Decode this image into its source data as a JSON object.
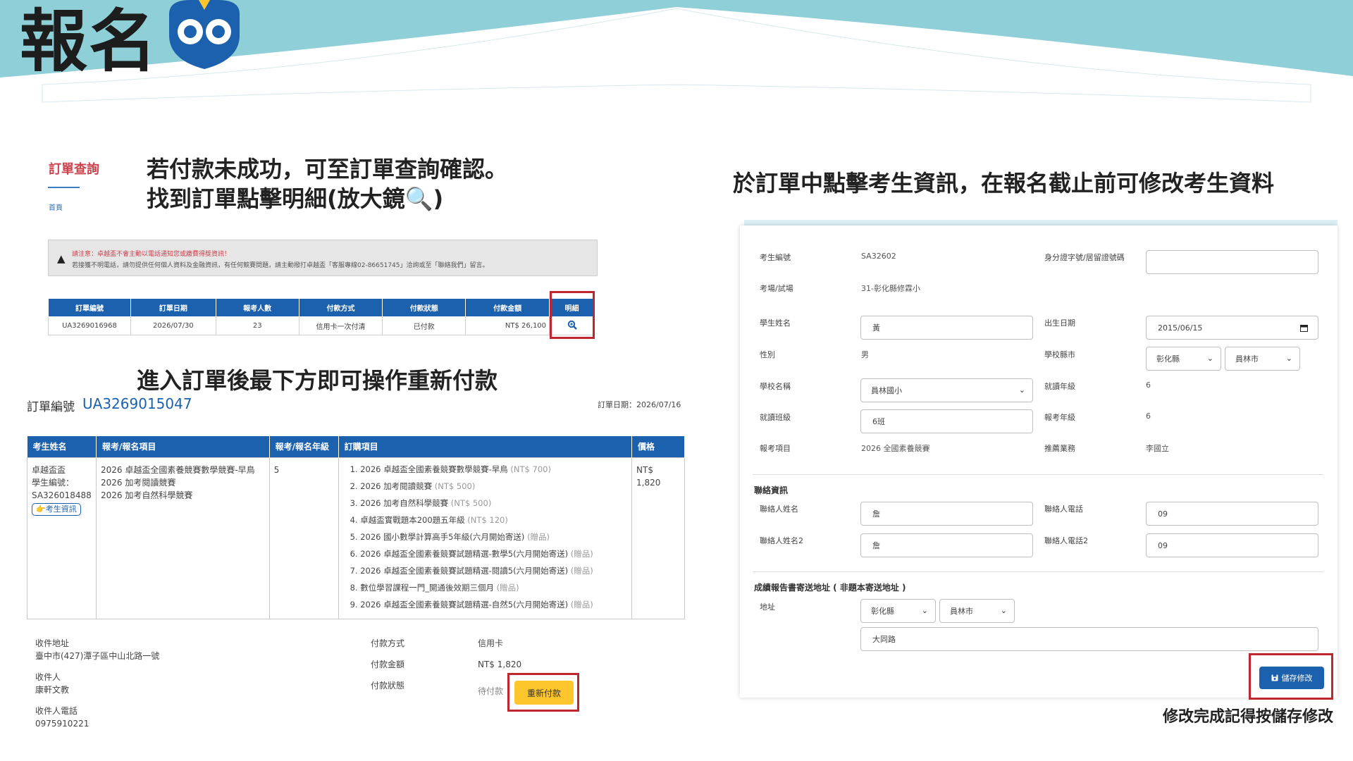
{
  "page": {
    "title": "報名",
    "colors": {
      "header_teal": "#8ecfd8",
      "primary_blue": "#1c61ad",
      "highlight_red": "#c0262d",
      "pay_yellow": "#fec62d"
    }
  },
  "instructions": {
    "step1_line1": "若付款未成功，可至訂單查詢確認。",
    "step1_line2": "找到訂單點擊明細(放大鏡🔍)",
    "step2": "進入訂單後最下方即可操作重新付款",
    "step3": "於訂單中點擊考生資訊，在報名截止前可修改考生資料",
    "step4": "修改完成記得按儲存修改"
  },
  "order_query": {
    "title": "訂單查詢",
    "breadcrumb": "首頁",
    "notice_line1": "請注意：卓越盃不會主動以電話通知您或繳費得獎資訊！",
    "notice_line2": "若接獲不明電話，請勿提供任何個人資料及金融資訊，有任何競賽問題，請主動撥打卓越盃「客服專線02-86651745」洽詢或至「聯絡我們」留言。",
    "table": {
      "headers": [
        "訂單編號",
        "訂單日期",
        "報考人數",
        "付款方式",
        "付款狀態",
        "付款金額",
        "明細"
      ],
      "row": {
        "order_no": "UA3269016968",
        "date": "2026/07/30",
        "count": "23",
        "method": "信用卡一次付清",
        "status": "已付款",
        "amount": "NT$ 26,100",
        "detail_icon": "magnifier-icon"
      }
    }
  },
  "order_detail": {
    "label": "訂單編號",
    "number": "UA3269015047",
    "date": "訂單日期：2026/07/16",
    "headers": [
      "考生姓名",
      "報考/報名項目",
      "報考/報名年級",
      "訂購項目",
      "價格"
    ],
    "student_name": "卓越盃盃",
    "student_id_label": "學生編號：",
    "student_id": "SA326018488",
    "student_info_btn": "👉考生資訊",
    "exam_items": [
      "2026 卓越盃全國素養競賽數學競賽-早鳥",
      "2026 加考閱讀競賽",
      "2026 加考自然科學競賽"
    ],
    "grade": "5",
    "purchase_items": [
      {
        "text": "1. 2026 卓越盃全國素養競賽數學競賽-早鳥",
        "note": "(NT$ 700)"
      },
      {
        "text": "2. 2026 加考閱讀競賽",
        "note": "(NT$ 500)"
      },
      {
        "text": "3. 2026 加考自然科學競賽",
        "note": "(NT$ 500)"
      },
      {
        "text": "4. 卓越盃實戰題本200題五年級",
        "note": "(NT$ 120)"
      },
      {
        "text": "5. 2026 國小數學計算高手5年級(六月開始寄送)",
        "note": "(贈品)"
      },
      {
        "text": "6. 2026 卓越盃全國素養競賽試題精選-數學5(六月開始寄送)",
        "note": "(贈品)"
      },
      {
        "text": "7. 2026 卓越盃全國素養競賽試題精選-閱讀5(六月開始寄送)",
        "note": "(贈品)"
      },
      {
        "text": "8. 數位學習課程一門_開通後效期三個月",
        "note": "(贈品)"
      },
      {
        "text": "9. 2026 卓越盃全國素養競賽試題精選-自然5(六月開始寄送)",
        "note": "(贈品)"
      }
    ],
    "price": "NT$ 1,820",
    "shipping_address_label": "收件地址",
    "shipping_address": "臺中市(427)潭子區中山北路一號",
    "recipient_label": "收件人",
    "recipient": "康軒文教",
    "recipient_phone_label": "收件人電話",
    "recipient_phone": "0975910221",
    "pay_method_label": "付款方式",
    "pay_method": "信用卡",
    "pay_amount_label": "付款金額",
    "pay_amount": "NT$ 1,820",
    "pay_status_label": "付款狀態",
    "pay_status": "待付款",
    "repay_btn": "重新付款"
  },
  "student_form": {
    "student_no_label": "考生編號",
    "student_no": "SA32602",
    "id_label": "身分證字號/居留證號碼",
    "id_value": "",
    "venue_label": "考場/試場",
    "venue": "31-彰化縣修霖小",
    "name_label": "學生姓名",
    "name_value": "黃",
    "birth_label": "出生日期",
    "birth_value": "2015/06/15",
    "gender_label": "性別",
    "gender": "男",
    "school_city_label": "學校縣市",
    "school_county": "彰化縣",
    "school_city": "員林市",
    "school_name_label": "學校名稱",
    "school_name": "員林國小",
    "grade_label": "就讀年級",
    "grade": "6",
    "class_label": "就讀班級",
    "class_value": "6班",
    "exam_grade_label": "報考年級",
    "exam_grade": "6",
    "exam_item_label": "報考項目",
    "exam_item": "2026 全國素養競賽",
    "recommend_label": "推薦業務",
    "recommend": "李國立",
    "contact_section": "聯絡資訊",
    "contact_name_label": "聯絡人姓名",
    "contact_name": "詹",
    "contact_phone_label": "聯絡人電話",
    "contact_phone": "09",
    "contact_name2_label": "聯絡人姓名2",
    "contact_name2": "詹",
    "contact_phone2_label": "聯絡人電話2",
    "contact_phone2": "09",
    "address_section": "成績報告書寄送地址 ( 非題本寄送地址 )",
    "address_label": "地址",
    "addr_county": "彰化縣",
    "addr_city": "員林市",
    "addr_detail": "大同路",
    "save_btn": "儲存修改"
  }
}
